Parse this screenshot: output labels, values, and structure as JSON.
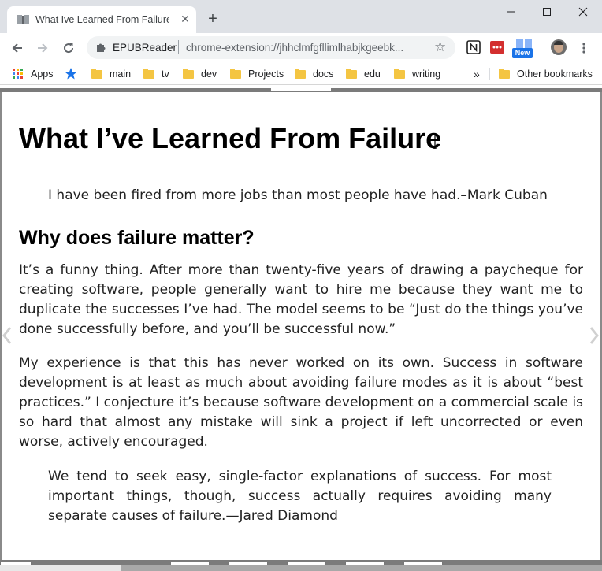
{
  "browser": {
    "tab_title": "What Ive Learned From Failure - E",
    "tab_close": "✕",
    "new_tab": "+",
    "site_name": "EPUBReader",
    "url": "chrome-extension://jhhclmfgfllimlhabjkgeebk...",
    "star": "☆",
    "extension_badge": "New"
  },
  "bookmarks": {
    "apps_label": "Apps",
    "items": [
      "main",
      "tv",
      "dev",
      "Projects",
      "docs",
      "edu",
      "writing"
    ],
    "overflow": "»",
    "other": "Other bookmarks"
  },
  "reader": {
    "title": "What I’ve Learned From Failure",
    "epigraph": "I have been fired from more jobs than most people have had.–Mark Cuban",
    "heading": "Why does failure matter?",
    "paragraph1": "It’s a funny thing. After more than twenty-five years of drawing a paycheque for creating software, people generally want to hire me because they want me to duplicate the successes I’ve had. The model seems to be “Just do the things you’ve done successfully before, and you’ll be successful now.”",
    "paragraph2": "My experience is that this has never worked on its own. Success in software development is at least as much about avoiding failure modes as it is about “best practices.” I conjecture it’s because software development on a commercial scale is so hard that almost any mistake will sink a project if left uncorrected or even worse, actively encouraged.",
    "quote2": "We tend to seek easy, single-factor explanations of success. For most important things, though, success actually requires avoiding many separate causes of failure.—Jared Diamond",
    "progress": 0.2
  },
  "colors": {
    "titlebar": "#dee1e6",
    "omnibox": "#f1f3f4",
    "folder": "#f4c542",
    "bookmark_star": "#1a73e8"
  },
  "icons": [
    "book-icon",
    "close-icon",
    "plus-icon",
    "minimize-icon",
    "maximize-icon",
    "window-close-icon",
    "back-icon",
    "forward-icon",
    "reload-icon",
    "puzzle-icon",
    "star-icon",
    "notion-icon",
    "todoist-icon",
    "new-extension-icon",
    "profile-avatar",
    "menu-dots-icon",
    "apps-grid-icon",
    "folder-icon",
    "prev-page-icon",
    "next-page-icon"
  ]
}
